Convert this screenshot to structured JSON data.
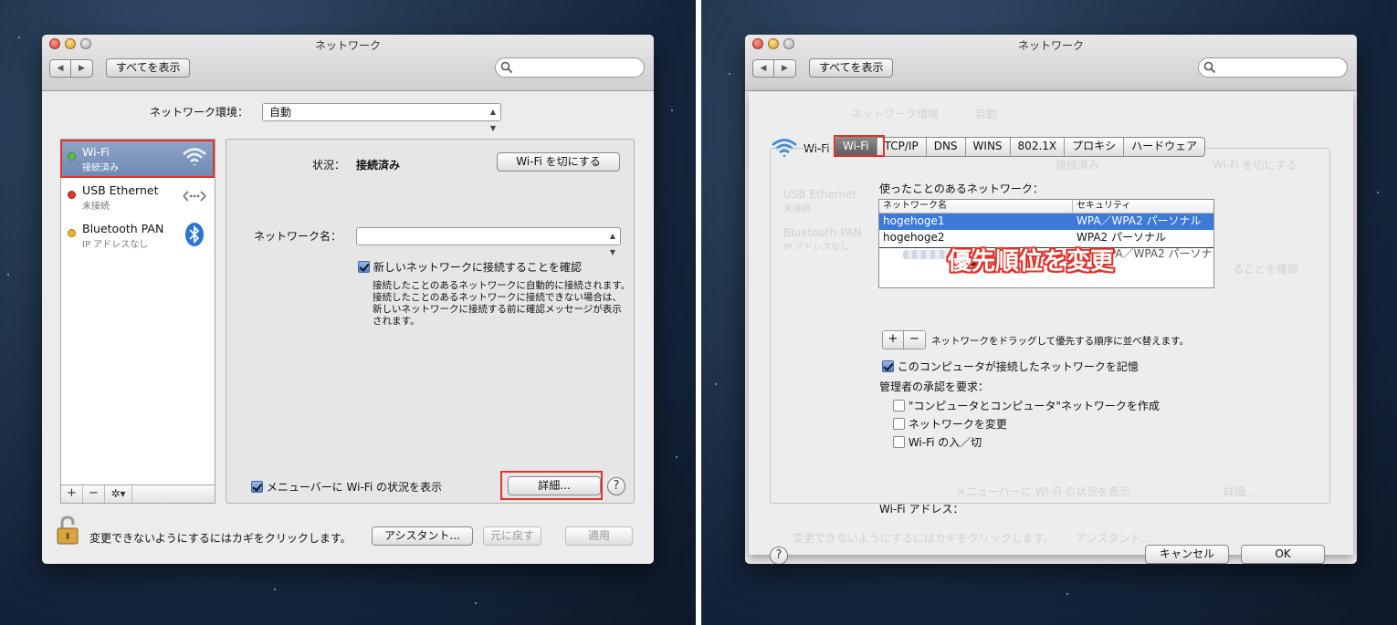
{
  "left_window": {
    "title": "ネットワーク",
    "nav_back": "◀",
    "nav_forward": "▶",
    "show_all": "すべてを表示",
    "search_placeholder": "",
    "location_label": "ネットワーク環境：",
    "location_value": "自動",
    "services": [
      {
        "name": "Wi-Fi",
        "status": "接続済み",
        "dot_color": "#5cc245",
        "icon": "wifi-icon",
        "selected": true
      },
      {
        "name": "USB Ethernet",
        "status": "未接続",
        "dot_color": "#d9372b",
        "icon": "ethernet-icon",
        "selected": false
      },
      {
        "name": "Bluetooth PAN",
        "status": "IP アドレスなし",
        "dot_color": "#e8b52a",
        "icon": "bluetooth-icon",
        "selected": false
      }
    ],
    "list_bar": {
      "add": "+",
      "remove": "−",
      "gear": "✲▾"
    },
    "status_label": "状況：",
    "status_value": "接続済み",
    "wifi_off_button": "Wi-Fi を切にする",
    "network_name_label": "ネットワーク名：",
    "network_name_value": "",
    "ask_join_label": "新しいネットワークに接続することを確認",
    "ask_join_checked": true,
    "ask_join_desc": [
      "接続したことのあるネットワークに自動的に接続されます。",
      "接続したことのあるネットワークに接続できない場合は、",
      "新しいネットワークに接続する前に確認メッセージが表示",
      "されます。"
    ],
    "menubar_label": "メニューバーに Wi-Fi の状況を表示",
    "menubar_checked": true,
    "advanced_button": "詳細...",
    "help": "?",
    "lock_text": "変更できないようにするにはカギをクリックします。",
    "assistant_button": "アシスタント...",
    "revert_button": "元に戻す",
    "apply_button": "適用"
  },
  "right_window": {
    "title": "ネットワーク",
    "nav_back": "◀",
    "nav_forward": "▶",
    "show_all": "すべてを表示",
    "wifi_header": "Wi-Fi",
    "tabs": [
      "Wi-Fi",
      "TCP/IP",
      "DNS",
      "WINS",
      "802.1X",
      "プロキシ",
      "ハードウェア"
    ],
    "selected_tab": "Wi-Fi",
    "preferred_label": "使ったことのあるネットワーク：",
    "table_headers": [
      "ネットワーク名",
      "セキュリティ"
    ],
    "table_rows": [
      {
        "name": "hogehoge1",
        "security": "WPA／WPA2 パーソナル",
        "selected": true
      },
      {
        "name": "hogehoge2",
        "security": "WPA2 パーソナル",
        "selected": false
      }
    ],
    "dragged_row_security": "WPA／WPA2 パーソナル",
    "overlay_annotation": "優先順位を変更",
    "add": "+",
    "remove": "−",
    "drag_hint": "ネットワークをドラッグして優先する順序に並べ替えます。",
    "remember_label": "このコンピュータが接続したネットワークを記憶",
    "remember_checked": true,
    "admin_label": "管理者の承認を要求：",
    "admin_options": [
      {
        "label": "\"コンピュータとコンピュータ\"ネットワークを作成",
        "checked": false
      },
      {
        "label": "ネットワークを変更",
        "checked": false
      },
      {
        "label": "Wi-Fi の入／切",
        "checked": false
      }
    ],
    "wifi_address_label": "Wi-Fi アドレス：",
    "wifi_address_value": "",
    "help": "?",
    "cancel_button": "キャンセル",
    "ok_button": "OK",
    "ghost_texts": {
      "location": "ネットワーク環境",
      "location_value": "自動",
      "status": "接続済み",
      "usb": "USB Ethernet",
      "usb_status": "未接続",
      "bt": "Bluetooth PAN",
      "bt_status": "IP アドレスなし",
      "wifi_off": "Wi-Fi を切にする",
      "ask": "ることを確認",
      "menubar": "メニューバーに Wi-Fi の状況を表示",
      "detail": "詳細...",
      "lock": "変更できないようにするにはカギをクリックします。",
      "assistant": "アシスタント..."
    }
  },
  "colors": {
    "highlight_red": "#e0332a",
    "selection_blue": "#3d7ad8"
  }
}
